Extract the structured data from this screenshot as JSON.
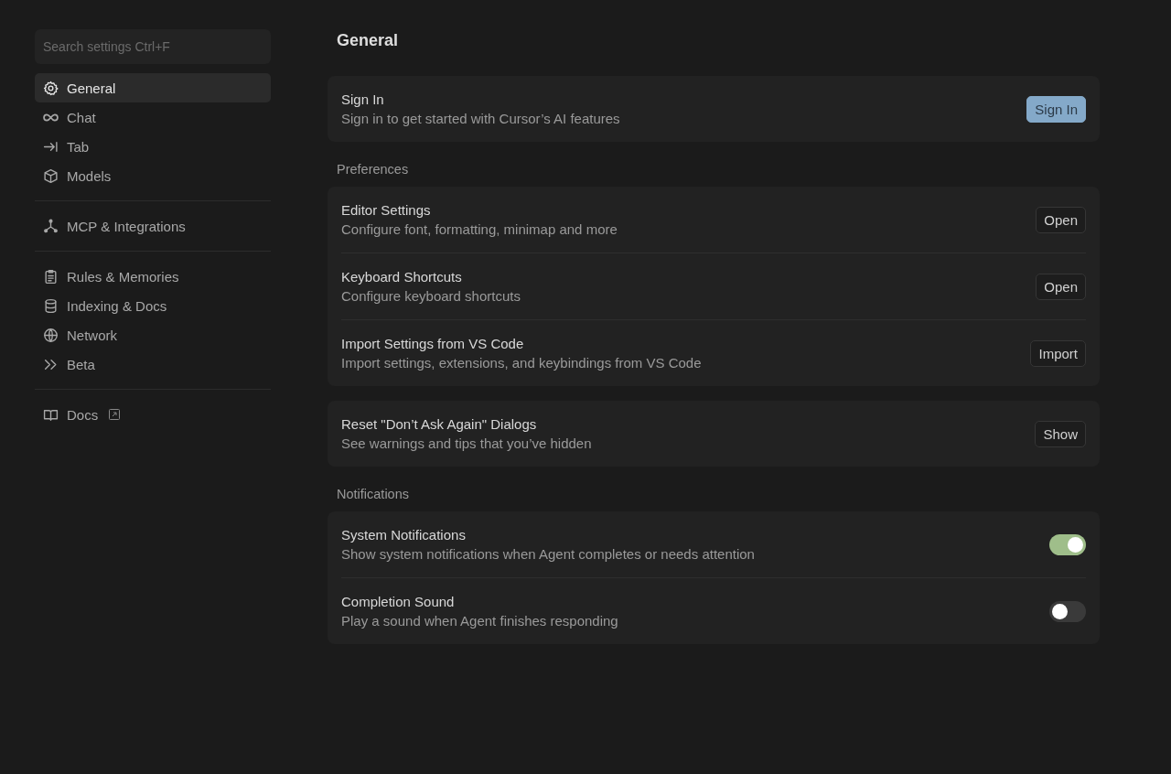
{
  "sidebar": {
    "search": {
      "placeholder": "Search settings Ctrl+F"
    },
    "groups": [
      {
        "items": [
          {
            "kind": "gear",
            "label": "General",
            "selected": true
          },
          {
            "kind": "infinity",
            "label": "Chat",
            "selected": false
          },
          {
            "kind": "arrow",
            "label": "Tab",
            "selected": false
          },
          {
            "kind": "cube",
            "label": "Models",
            "selected": false
          }
        ]
      },
      {
        "items": [
          {
            "kind": "nodes",
            "label": "MCP & Integrations",
            "selected": false
          }
        ]
      },
      {
        "items": [
          {
            "kind": "clipboard",
            "label": "Rules & Memories",
            "selected": false
          },
          {
            "kind": "database",
            "label": "Indexing & Docs",
            "selected": false
          },
          {
            "kind": "globe",
            "label": "Network",
            "selected": false
          },
          {
            "kind": "chevrons",
            "label": "Beta",
            "selected": false
          }
        ]
      },
      {
        "items": [
          {
            "kind": "book",
            "label": "Docs",
            "selected": false,
            "external": true
          }
        ]
      }
    ]
  },
  "page": {
    "title": "General",
    "sections": [
      {
        "rows": [
          {
            "kind": "button",
            "title": "Sign In",
            "description": "Sign in to get started with Cursor’s AI features",
            "button": "Sign In",
            "primary": true
          }
        ]
      },
      {
        "heading": "Preferences",
        "rows": [
          {
            "kind": "button",
            "title": "Editor Settings",
            "description": "Configure font, formatting, minimap and more",
            "button": "Open",
            "primary": false
          },
          {
            "kind": "button",
            "title": "Keyboard Shortcuts",
            "description": "Configure keyboard shortcuts",
            "button": "Open",
            "primary": false
          },
          {
            "kind": "button",
            "title": "Import Settings from VS Code",
            "description": "Import settings, extensions, and keybindings from VS Code",
            "button": "Import",
            "primary": false
          }
        ]
      },
      {
        "rows": [
          {
            "kind": "button",
            "title": "Reset \"Don’t Ask Again\" Dialogs",
            "description": "See warnings and tips that you’ve hidden",
            "button": "Show",
            "primary": false
          }
        ]
      },
      {
        "heading": "Notifications",
        "rows": [
          {
            "kind": "toggle",
            "title": "System Notifications",
            "description": "Show system notifications when Agent completes or needs attention",
            "on": true
          },
          {
            "kind": "toggle",
            "title": "Completion Sound",
            "description": "Play a sound when Agent finishes responding",
            "on": false
          }
        ]
      }
    ]
  }
}
